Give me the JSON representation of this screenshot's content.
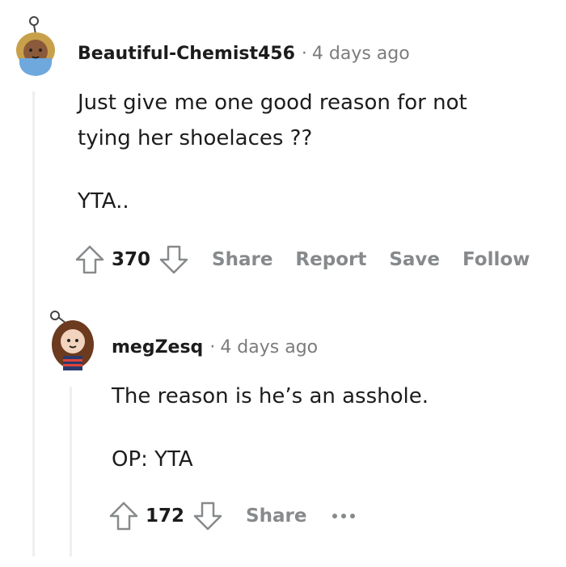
{
  "comment1": {
    "author": "Beautiful-Chemist456",
    "separator": "·",
    "time": "4 days ago",
    "body_line1": "Just give me one good reason for not",
    "body_line2": "tying her shoelaces ??",
    "body_line3": "YTA..",
    "upvotes": "370",
    "share_label": "Share",
    "report_label": "Report",
    "save_label": "Save",
    "follow_label": "Follow"
  },
  "comment2": {
    "author": "megZesq",
    "separator": "·",
    "time": "4 days ago",
    "body_line1": "The reason is he’s an asshole.",
    "body_line2": "OP: YTA",
    "upvotes": "172",
    "share_label": "Share"
  },
  "icons": {
    "upvote": "upvote-arrow-icon",
    "downvote": "downvote-arrow-icon",
    "more": "more-options-icon"
  }
}
